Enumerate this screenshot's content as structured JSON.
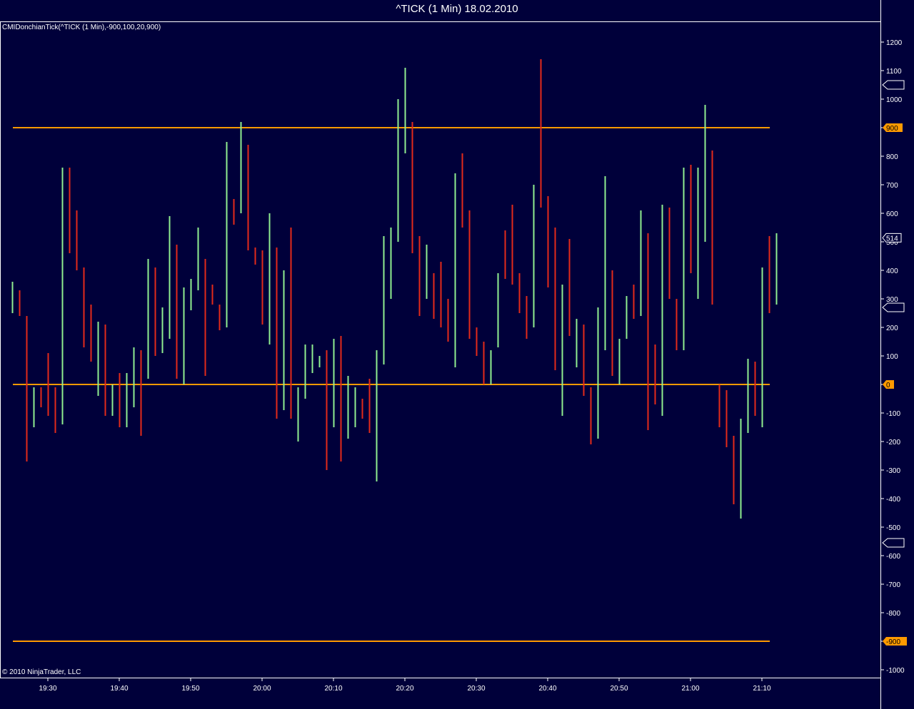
{
  "title": "^TICK (1 Min)  18.02.2010",
  "indicator_label": "CMIDonchianTick(^TICK (1 Min),-900,100,20,900)",
  "copyright": "© 2010 NinjaTrader, LLC",
  "colors": {
    "background": "#00003a",
    "up": "#90ee90",
    "down": "#e32a1a",
    "level": "#ff9a00",
    "frame": "#ffffff"
  },
  "chart_data": {
    "type": "bar",
    "title": "^TICK (1 Min)  18.02.2010",
    "ylim": [
      -1000,
      1200
    ],
    "y_ticks": [
      1200,
      1100,
      1000,
      900,
      800,
      700,
      600,
      500,
      400,
      300,
      200,
      100,
      0,
      -100,
      -200,
      -300,
      -400,
      -500,
      -600,
      -700,
      -800,
      -900,
      -1000
    ],
    "x_ticks": [
      "19:30",
      "19:40",
      "19:50",
      "20:00",
      "20:10",
      "20:20",
      "20:30",
      "20:40",
      "20:50",
      "21:00",
      "21:10"
    ],
    "levels": [
      {
        "value": 900,
        "label": "900"
      },
      {
        "value": 0,
        "label": "0"
      },
      {
        "value": -900,
        "label": "-900"
      }
    ],
    "last_value": {
      "value": 514,
      "label": "514"
    },
    "empty_markers": [
      1050,
      270,
      -555
    ],
    "grid": false,
    "bars": [
      [
        "19:25",
        "up",
        360,
        250
      ],
      [
        "19:26",
        "down",
        330,
        240
      ],
      [
        "19:27",
        "down",
        240,
        -270
      ],
      [
        "19:28",
        "up",
        -10,
        -150
      ],
      [
        "19:29",
        "down",
        -10,
        -80
      ],
      [
        "19:30",
        "down",
        110,
        -110
      ],
      [
        "19:31",
        "down",
        -10,
        -170
      ],
      [
        "19:32",
        "up",
        760,
        -140
      ],
      [
        "19:33",
        "down",
        760,
        460
      ],
      [
        "19:34",
        "down",
        610,
        400
      ],
      [
        "19:35",
        "down",
        410,
        130
      ],
      [
        "19:36",
        "down",
        280,
        80
      ],
      [
        "19:37",
        "up",
        220,
        -40
      ],
      [
        "19:38",
        "down",
        210,
        -110
      ],
      [
        "19:39",
        "up",
        0,
        -110
      ],
      [
        "19:40",
        "down",
        40,
        -150
      ],
      [
        "19:41",
        "up",
        40,
        -150
      ],
      [
        "19:42",
        "up",
        130,
        -80
      ],
      [
        "19:43",
        "down",
        120,
        -180
      ],
      [
        "19:44",
        "up",
        440,
        20
      ],
      [
        "19:45",
        "down",
        410,
        100
      ],
      [
        "19:46",
        "up",
        270,
        110
      ],
      [
        "19:47",
        "up",
        590,
        160
      ],
      [
        "19:48",
        "down",
        490,
        20
      ],
      [
        "19:49",
        "up",
        340,
        0
      ],
      [
        "19:50",
        "up",
        370,
        260
      ],
      [
        "19:51",
        "up",
        550,
        330
      ],
      [
        "19:52",
        "down",
        440,
        30
      ],
      [
        "19:53",
        "down",
        350,
        280
      ],
      [
        "19:54",
        "down",
        280,
        190
      ],
      [
        "19:55",
        "up",
        850,
        200
      ],
      [
        "19:56",
        "down",
        650,
        560
      ],
      [
        "19:57",
        "up",
        920,
        600
      ],
      [
        "19:58",
        "down",
        840,
        470
      ],
      [
        "19:59",
        "down",
        480,
        420
      ],
      [
        "20:00",
        "down",
        470,
        210
      ],
      [
        "20:01",
        "up",
        600,
        140
      ],
      [
        "20:02",
        "down",
        480,
        -120
      ],
      [
        "20:03",
        "up",
        400,
        -90
      ],
      [
        "20:04",
        "down",
        550,
        -120
      ],
      [
        "20:05",
        "up",
        -10,
        -200
      ],
      [
        "20:06",
        "up",
        140,
        -50
      ],
      [
        "20:07",
        "up",
        140,
        40
      ],
      [
        "20:08",
        "up",
        100,
        60
      ],
      [
        "20:09",
        "down",
        120,
        -300
      ],
      [
        "20:10",
        "up",
        160,
        -150
      ],
      [
        "20:11",
        "down",
        170,
        -270
      ],
      [
        "20:12",
        "up",
        30,
        -190
      ],
      [
        "20:13",
        "up",
        -10,
        -150
      ],
      [
        "20:14",
        "down",
        -50,
        -120
      ],
      [
        "20:15",
        "down",
        20,
        -170
      ],
      [
        "20:16",
        "up",
        120,
        -340
      ],
      [
        "20:17",
        "up",
        520,
        70
      ],
      [
        "20:18",
        "up",
        550,
        300
      ],
      [
        "20:19",
        "up",
        1000,
        500
      ],
      [
        "20:20",
        "up",
        1110,
        810
      ],
      [
        "20:21",
        "down",
        920,
        460
      ],
      [
        "20:22",
        "down",
        520,
        240
      ],
      [
        "20:23",
        "up",
        490,
        300
      ],
      [
        "20:24",
        "down",
        390,
        230
      ],
      [
        "20:25",
        "down",
        430,
        200
      ],
      [
        "20:26",
        "down",
        300,
        150
      ],
      [
        "20:27",
        "up",
        740,
        60
      ],
      [
        "20:28",
        "down",
        810,
        550
      ],
      [
        "20:29",
        "down",
        610,
        160
      ],
      [
        "20:30",
        "down",
        200,
        100
      ],
      [
        "20:31",
        "down",
        150,
        0
      ],
      [
        "20:32",
        "up",
        120,
        0
      ],
      [
        "20:33",
        "up",
        390,
        130
      ],
      [
        "20:34",
        "down",
        540,
        370
      ],
      [
        "20:35",
        "down",
        630,
        350
      ],
      [
        "20:36",
        "down",
        390,
        250
      ],
      [
        "20:37",
        "down",
        310,
        160
      ],
      [
        "20:38",
        "up",
        700,
        200
      ],
      [
        "20:39",
        "down",
        1140,
        620
      ],
      [
        "20:40",
        "down",
        660,
        340
      ],
      [
        "20:41",
        "down",
        550,
        50
      ],
      [
        "20:42",
        "up",
        350,
        -110
      ],
      [
        "20:43",
        "down",
        510,
        170
      ],
      [
        "20:44",
        "up",
        230,
        60
      ],
      [
        "20:45",
        "down",
        210,
        -40
      ],
      [
        "20:46",
        "down",
        -10,
        -210
      ],
      [
        "20:47",
        "up",
        270,
        -190
      ],
      [
        "20:48",
        "up",
        730,
        120
      ],
      [
        "20:49",
        "down",
        400,
        30
      ],
      [
        "20:50",
        "up",
        160,
        0
      ],
      [
        "20:51",
        "up",
        310,
        160
      ],
      [
        "20:52",
        "down",
        350,
        230
      ],
      [
        "20:53",
        "up",
        610,
        240
      ],
      [
        "20:54",
        "down",
        530,
        -160
      ],
      [
        "20:55",
        "down",
        140,
        -70
      ],
      [
        "20:56",
        "up",
        630,
        -110
      ],
      [
        "20:57",
        "down",
        620,
        300
      ],
      [
        "20:58",
        "down",
        300,
        120
      ],
      [
        "20:59",
        "up",
        760,
        120
      ],
      [
        "21:00",
        "down",
        770,
        390
      ],
      [
        "21:01",
        "up",
        760,
        300
      ],
      [
        "21:02",
        "up",
        980,
        500
      ],
      [
        "21:03",
        "down",
        820,
        280
      ],
      [
        "21:04",
        "down",
        0,
        -150
      ],
      [
        "21:05",
        "down",
        -20,
        -220
      ],
      [
        "21:06",
        "down",
        -180,
        -420
      ],
      [
        "21:07",
        "up",
        -120,
        -470
      ],
      [
        "21:08",
        "up",
        90,
        -170
      ],
      [
        "21:09",
        "down",
        80,
        -110
      ],
      [
        "21:10",
        "up",
        410,
        -150
      ],
      [
        "21:11",
        "down",
        520,
        250
      ],
      [
        "21:12",
        "up",
        530,
        280
      ]
    ]
  }
}
